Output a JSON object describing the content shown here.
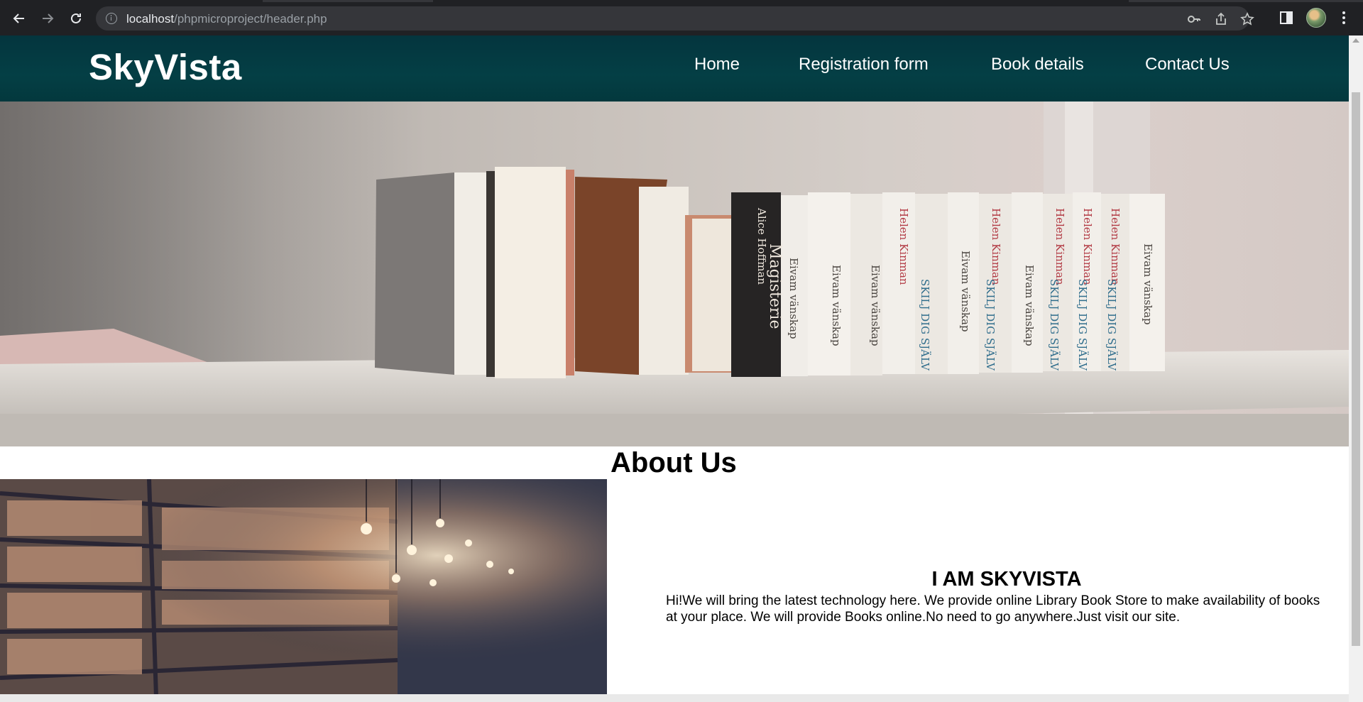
{
  "browser": {
    "url_host": "localhost",
    "url_path": "/phpmicroproject/header.php",
    "icons": [
      "back-arrow-icon",
      "forward-arrow-icon",
      "reload-icon",
      "info-icon",
      "key-icon",
      "share-icon",
      "star-icon",
      "side-panel-icon",
      "profile-avatar",
      "kebab-menu-icon"
    ]
  },
  "site": {
    "brand": "SkyVista",
    "nav": [
      "Home",
      "Registration form",
      "Book details",
      "Contact Us"
    ],
    "header_color": "#043f45"
  },
  "about": {
    "title": "About Us",
    "heading": "I AM SKYVISTA",
    "text": "Hi!We will bring the latest technology here. We provide online Library Book Store to make availability of books at your place. We will provide Books online.No need to go anywhere.Just visit our site."
  },
  "hero": {
    "spines": [
      {
        "title": "Alice Hoffman",
        "subtitle": "Magisterie"
      },
      {
        "title": "Eivam vänskap"
      },
      {
        "title": "Eivam vänskap"
      },
      {
        "title": "Eivam vänskap"
      },
      {
        "title": "Helen Kinman",
        "subtitle": "SKILJ DIG SJÄLV"
      },
      {
        "title": "Eivam vänskap"
      },
      {
        "title": "Helen Kinman",
        "subtitle": "SKILJ DIG SJÄLV"
      },
      {
        "title": "Eivam vänskap"
      },
      {
        "title": "Helen Kinman",
        "subtitle": "SKILJ DIG SJÄLV"
      },
      {
        "title": "Helen Kinman",
        "subtitle": "SKILJ DIG SJÄLV"
      },
      {
        "title": "Helen Kinman",
        "subtitle": "SKILJ DIG SJÄLV"
      },
      {
        "title": "Eivam vänskap"
      }
    ]
  }
}
